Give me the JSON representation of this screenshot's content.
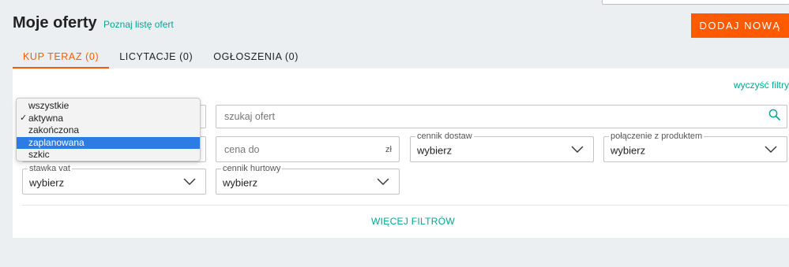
{
  "header": {
    "title": "Moje oferty",
    "learn_link": "Poznaj listę ofert",
    "add_button": "DODAJ NOWĄ"
  },
  "tabs": [
    {
      "label": "KUP TERAZ (0)",
      "active": true
    },
    {
      "label": "LICYTACJE (0)",
      "active": false
    },
    {
      "label": "OGŁOSZENIA (0)",
      "active": false
    }
  ],
  "filters": {
    "clear_label": "wyczyść filtry",
    "search": {
      "placeholder": "szukaj ofert",
      "icon": "search-icon"
    },
    "price_to": {
      "placeholder": "cena do",
      "unit": "zł"
    },
    "shipping_rates": {
      "legend": "cennik dostaw",
      "value": "wybierz"
    },
    "product_link": {
      "legend": "połączenie z produktem",
      "value": "wybierz"
    },
    "vat_rate": {
      "legend": "stawka vat",
      "value": "wybierz"
    },
    "wholesale_price": {
      "legend": "cennik hurtowy",
      "value": "wybierz"
    },
    "more_filters": "WIĘCEJ FILTRÓW"
  },
  "status_dropdown": {
    "options": [
      {
        "label": "wszystkie",
        "checked": false,
        "highlighted": false
      },
      {
        "label": "aktywna",
        "checked": true,
        "highlighted": false
      },
      {
        "label": "zakończona",
        "checked": false,
        "highlighted": false
      },
      {
        "label": "zaplanowana",
        "checked": false,
        "highlighted": true
      },
      {
        "label": "szkic",
        "checked": false,
        "highlighted": false
      }
    ],
    "check_mark": "✓"
  },
  "colors": {
    "accent": "#ff5a00",
    "link": "#00a790",
    "highlight": "#2d7be5",
    "background": "#eceff1"
  }
}
